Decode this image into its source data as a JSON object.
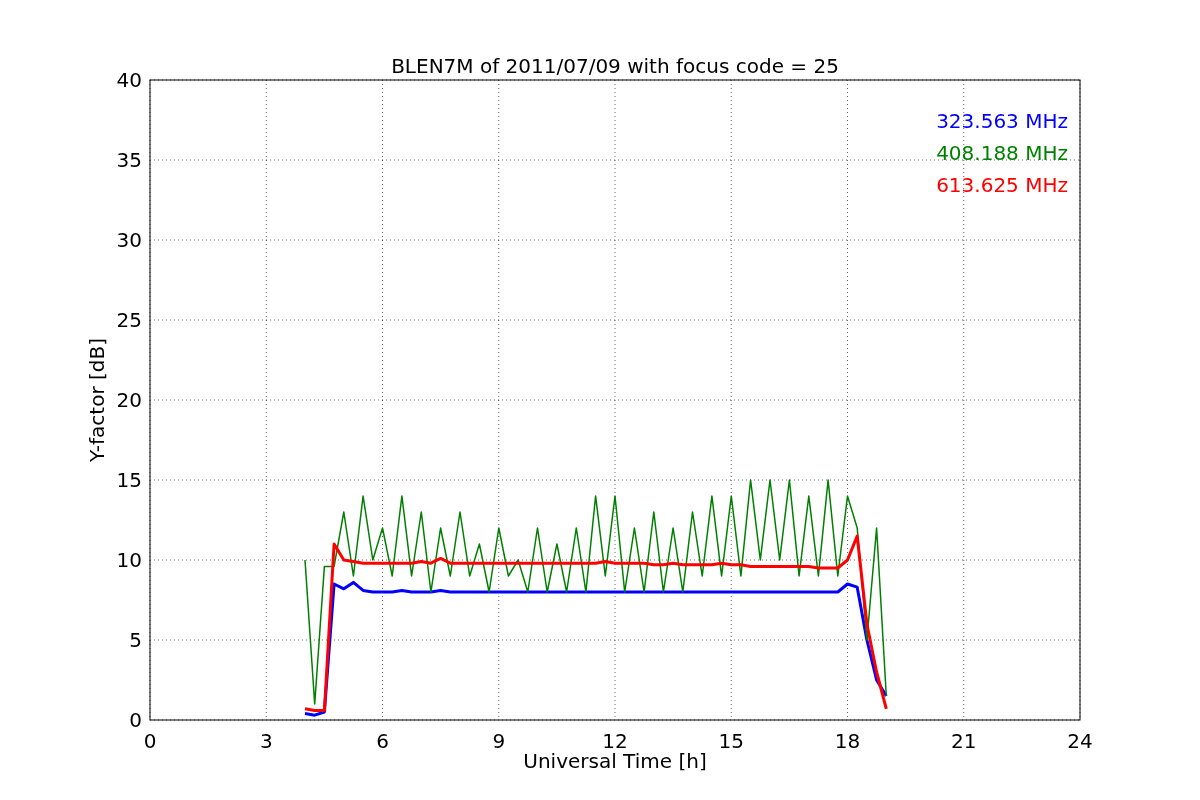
{
  "chart_data": {
    "type": "line",
    "title": "BLEN7M of 2011/07/09 with focus code = 25",
    "xlabel": "Universal Time [h]",
    "ylabel": "Y-factor [dB]",
    "xlim": [
      0,
      24
    ],
    "ylim": [
      0,
      40
    ],
    "xticks": [
      0,
      3,
      6,
      9,
      12,
      15,
      18,
      21,
      24
    ],
    "yticks": [
      0,
      5,
      10,
      15,
      20,
      25,
      30,
      35,
      40
    ],
    "grid": true,
    "x": [
      4,
      4.25,
      4.5,
      4.75,
      5,
      5.25,
      5.5,
      5.75,
      6,
      6.25,
      6.5,
      6.75,
      7,
      7.25,
      7.5,
      7.75,
      8,
      8.25,
      8.5,
      8.75,
      9,
      9.25,
      9.5,
      9.75,
      10,
      10.25,
      10.5,
      10.75,
      11,
      11.25,
      11.5,
      11.75,
      12,
      12.25,
      12.5,
      12.75,
      13,
      13.25,
      13.5,
      13.75,
      14,
      14.25,
      14.5,
      14.75,
      15,
      15.25,
      15.5,
      15.75,
      16,
      16.25,
      16.5,
      16.75,
      17,
      17.25,
      17.5,
      17.75,
      18,
      18.25,
      18.5,
      18.75,
      19
    ],
    "series": [
      {
        "name": "323.563 MHz",
        "color": "#0000ff",
        "values": [
          0.4,
          0.3,
          0.5,
          8.5,
          8.2,
          8.6,
          8.1,
          8,
          8,
          8,
          8.1,
          8,
          8,
          8,
          8.1,
          8,
          8,
          8,
          8,
          8,
          8,
          8,
          8,
          8,
          8,
          8,
          8,
          8,
          8,
          8,
          8,
          8,
          8,
          8,
          8,
          8,
          8,
          8,
          8,
          8,
          8,
          8,
          8,
          8,
          8,
          8,
          8,
          8,
          8,
          8,
          8,
          8,
          8,
          8,
          8,
          8,
          8.5,
          8.3,
          5,
          2.5,
          1.5
        ]
      },
      {
        "name": "408.188 MHz",
        "color": "#008000",
        "values": [
          10,
          1,
          9.6,
          9.6,
          13,
          9,
          14,
          10,
          12,
          9,
          14,
          9,
          13,
          8,
          12,
          9,
          13,
          9,
          11,
          8,
          12,
          9,
          10,
          8,
          12,
          8,
          11,
          8,
          12,
          8,
          14,
          9,
          14,
          8,
          12,
          8,
          13,
          8,
          12,
          8,
          13,
          9,
          14,
          9,
          14,
          9,
          15,
          10,
          15,
          10,
          15,
          9,
          14,
          9,
          15,
          9,
          14,
          12,
          5,
          12,
          1.5
        ]
      },
      {
        "name": "613.625 MHz",
        "color": "#ff0000",
        "values": [
          0.7,
          0.6,
          0.6,
          11,
          10,
          9.9,
          9.8,
          9.8,
          9.8,
          9.8,
          9.8,
          9.8,
          9.9,
          9.8,
          10.1,
          9.8,
          9.8,
          9.8,
          9.8,
          9.8,
          9.8,
          9.8,
          9.8,
          9.8,
          9.8,
          9.8,
          9.8,
          9.8,
          9.8,
          9.8,
          9.8,
          9.9,
          9.8,
          9.8,
          9.8,
          9.8,
          9.7,
          9.7,
          9.8,
          9.7,
          9.7,
          9.7,
          9.7,
          9.8,
          9.7,
          9.7,
          9.6,
          9.6,
          9.6,
          9.6,
          9.6,
          9.6,
          9.6,
          9.5,
          9.5,
          9.5,
          10,
          11.5,
          6,
          3,
          0.7
        ]
      }
    ]
  }
}
